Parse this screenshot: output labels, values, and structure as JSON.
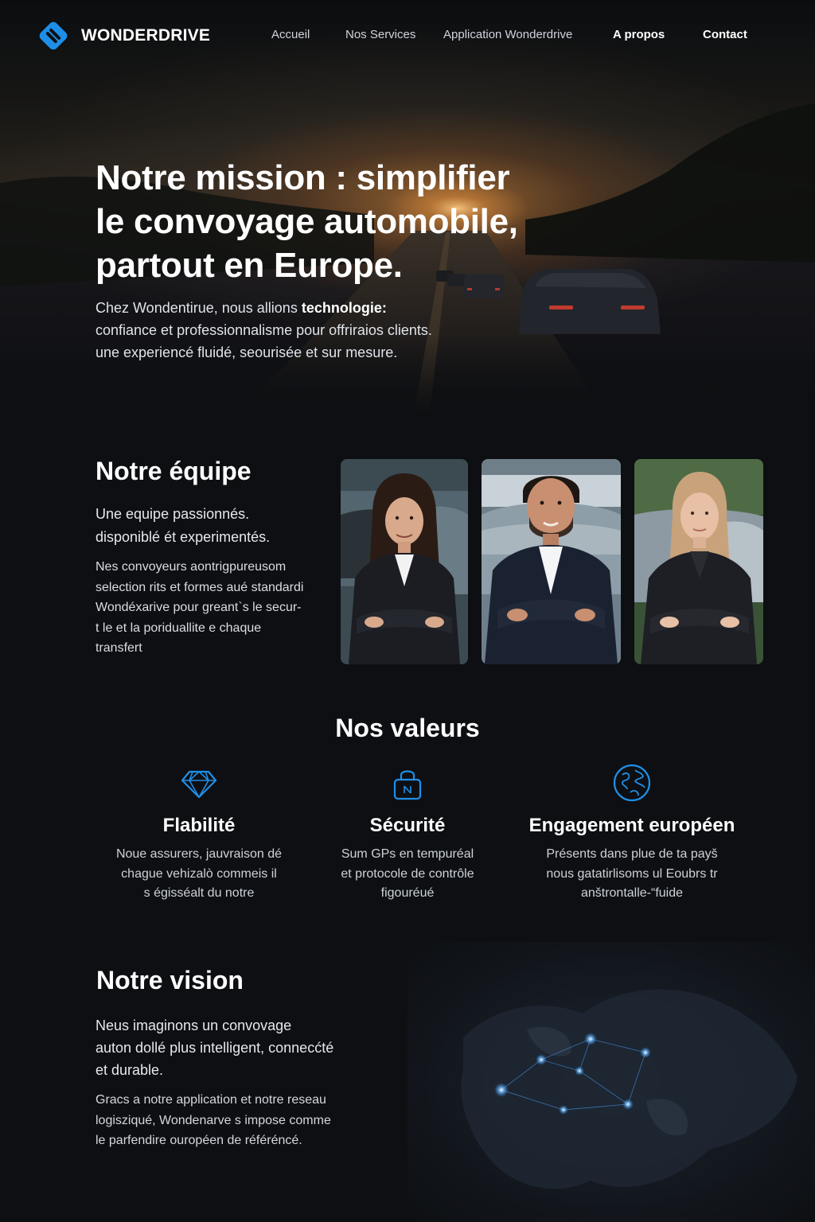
{
  "brand": {
    "name": "WONDERDRIVE",
    "accent": "#1e8fe8"
  },
  "nav": {
    "items": [
      "Accueil",
      "Nos Services",
      "Application Wonderdrive",
      "A propos",
      "Contact"
    ],
    "active": "A propos"
  },
  "hero": {
    "title_lines": [
      "Notre mission : simplifier",
      "le convoyage automobile,",
      "partout en Europe."
    ],
    "text_line1_prefix": "Chez Wondentirue, nous allions ",
    "text_line1_bold": "technologie:",
    "text_line2": "confiance et professionnalisme pour offriraios clients.",
    "text_line3": "une experiencé fluidé, seourisée et sur mesure."
  },
  "team": {
    "title": "Notre équipe",
    "lead_lines": [
      "Une equipe passionnés.",
      "disponiblé ét experimentés."
    ],
    "body_lines": [
      "Nes convoyeurs aontrigpureusom",
      "selection rits et formes aué standardi",
      "Wondéxarive pour greant`s le secur-",
      "t le et la poriduallite e chaque",
      "transfert"
    ],
    "photos": [
      {
        "name": "team-member-woman-dark-hair"
      },
      {
        "name": "team-member-man-beard"
      },
      {
        "name": "team-member-woman-blonde"
      }
    ]
  },
  "values": {
    "title": "Nos valeurs",
    "items": [
      {
        "icon": "diamond-icon",
        "title": "Flabilité",
        "lines": [
          "Noue assurers, jauvraison dé",
          "chague vehizalò commeis il",
          "s égisséalt du notre"
        ]
      },
      {
        "icon": "lock-icon",
        "title": "Sécurité",
        "lines": [
          "Sum GPs en tempuréal",
          "et protocole de contrôle",
          "figouréué"
        ]
      },
      {
        "icon": "globe-icon",
        "title": "Engagement européen",
        "lines": [
          "Présents dans plue de ta payš",
          "nous gatatirlisoms ul Eoubrs tr",
          "anštrontalle-“fuide"
        ]
      }
    ]
  },
  "vision": {
    "title": "Notre vision",
    "lead_lines": [
      "Neus imaginons un convovage",
      "auton dollé plus intelligent, connecćté",
      "et durable."
    ],
    "body_lines": [
      "Gracs a notre application et notre reseau",
      "logisziqué, Wondenarve s impose comme",
      "le parfendire ouropéen de référéncé."
    ]
  }
}
